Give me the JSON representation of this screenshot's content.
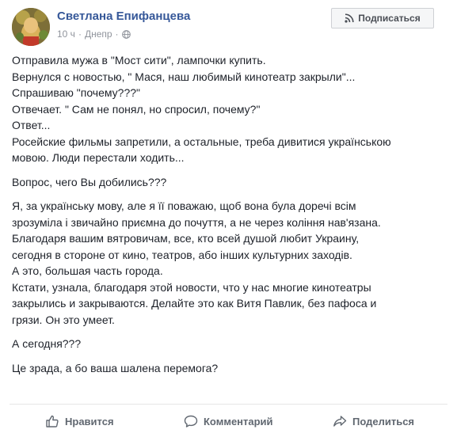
{
  "author": {
    "name": "Светлана Епифанцева",
    "time": "10 ч",
    "location": "Днепр",
    "separator": "·"
  },
  "subscribe": {
    "label": "Подписаться"
  },
  "post": {
    "paragraphs": [
      [
        "Отправила мужа в \"Мост сити\", лампочки купить.",
        "Вернулся с новостью, \" Мася, наш любимый кинотеатр закрыли\"...",
        "Спрашиваю \"почему???\"",
        "Отвечает. \" Сам не понял, но спросил, почему?\"",
        "Ответ...",
        "Росейские фильмы запретили, а остальные, треба дивитися українською",
        "мовою. Люди перестали ходить..."
      ],
      [
        "Вопрос, чего Вы добились???"
      ],
      [
        "Я, за українську мову, але я її поважаю, щоб вона була доречі всім",
        "зрозуміла і звичайно приємна до почуття, а не через коління нав'язана.",
        "Благодаря вашим вятровичам, все, кто всей душой любит Украину,",
        "сегодня в стороне от кино, театров, або інших культурних заходів.",
        "А это, большая часть города.",
        "Кстати, узнала, благодаря этой новости, что у нас многие кинотеатры",
        "закрылись и закрываются. Делайте это как Витя Павлик, без пафоса и",
        "грязи. Он это умеет."
      ],
      [
        "А сегодня???"
      ],
      [
        "Це зрада, а бо ваша шалена перемога?"
      ]
    ]
  },
  "actions": {
    "like": "Нравится",
    "comment": "Комментарий",
    "share": "Поделиться"
  },
  "colors": {
    "name": "#365899",
    "meta": "#90949c",
    "text": "#1d2129",
    "action": "#606770"
  },
  "icons": {
    "globe": "globe-icon",
    "subscribe": "rss-icon",
    "like": "thumbs-up-icon",
    "comment": "comment-bubble-icon",
    "share": "share-arrow-icon"
  }
}
